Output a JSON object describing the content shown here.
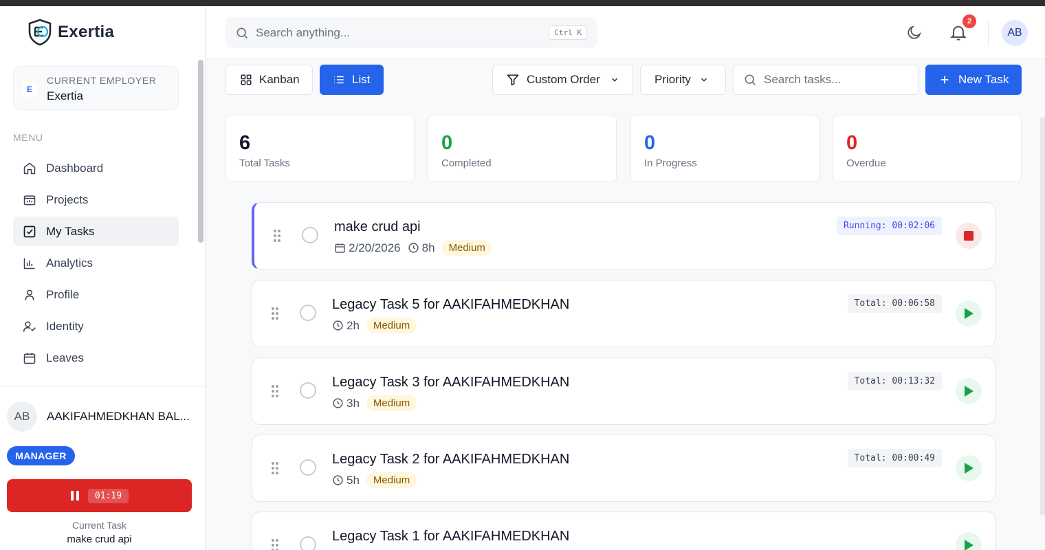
{
  "brand": {
    "name": "Exertia"
  },
  "employer": {
    "badge": "E",
    "caption": "CURRENT EMPLOYER",
    "name": "Exertia"
  },
  "menu": {
    "heading": "MENU",
    "items": [
      {
        "label": "Dashboard",
        "icon": "home-icon"
      },
      {
        "label": "Projects",
        "icon": "projects-icon"
      },
      {
        "label": "My Tasks",
        "icon": "checkbox-icon",
        "active": true
      },
      {
        "label": "Analytics",
        "icon": "bar-chart-icon"
      },
      {
        "label": "Profile",
        "icon": "user-icon"
      },
      {
        "label": "Identity",
        "icon": "user-check-icon"
      },
      {
        "label": "Leaves",
        "icon": "calendar-icon"
      }
    ]
  },
  "user": {
    "initials": "AB",
    "name": "AAKIFAHMEDKHAN BAL...",
    "role": "MANAGER"
  },
  "sidebar_timer": {
    "value": "01:19",
    "caption": "Current Task",
    "task": "make crud api"
  },
  "header": {
    "search_placeholder": "Search anything...",
    "shortcut": "Ctrl K",
    "notifications": "2",
    "avatar": "AB"
  },
  "toolbar": {
    "kanban": "Kanban",
    "list": "List",
    "sort": "Custom Order",
    "priority": "Priority",
    "search_placeholder": "Search tasks...",
    "new_task": "New Task"
  },
  "stats": [
    {
      "value": "6",
      "label": "Total Tasks",
      "color": "#111827"
    },
    {
      "value": "0",
      "label": "Completed",
      "color": "#16a34a"
    },
    {
      "value": "0",
      "label": "In Progress",
      "color": "#2563eb"
    },
    {
      "value": "0",
      "label": "Overdue",
      "color": "#dc2626"
    }
  ],
  "tasks": [
    {
      "title": "make crud api",
      "date": "2/20/2026",
      "hours": "8h",
      "priority": "Medium",
      "timer": "Running: 00:02:06"
    },
    {
      "title": "Legacy Task 5 for AAKIFAHMEDKHAN",
      "hours": "2h",
      "priority": "Medium",
      "timer": "Total: 00:06:58"
    },
    {
      "title": "Legacy Task 3 for AAKIFAHMEDKHAN",
      "hours": "3h",
      "priority": "Medium",
      "timer": "Total: 00:13:32"
    },
    {
      "title": "Legacy Task 2 for AAKIFAHMEDKHAN",
      "hours": "5h",
      "priority": "Medium",
      "timer": "Total: 00:00:49"
    },
    {
      "title": "Legacy Task 1 for AAKIFAHMEDKHAN"
    }
  ],
  "colors": {
    "accent": "#2563eb",
    "running": "#6366f1",
    "stop": "#dc2626",
    "play": "#16a34a"
  }
}
